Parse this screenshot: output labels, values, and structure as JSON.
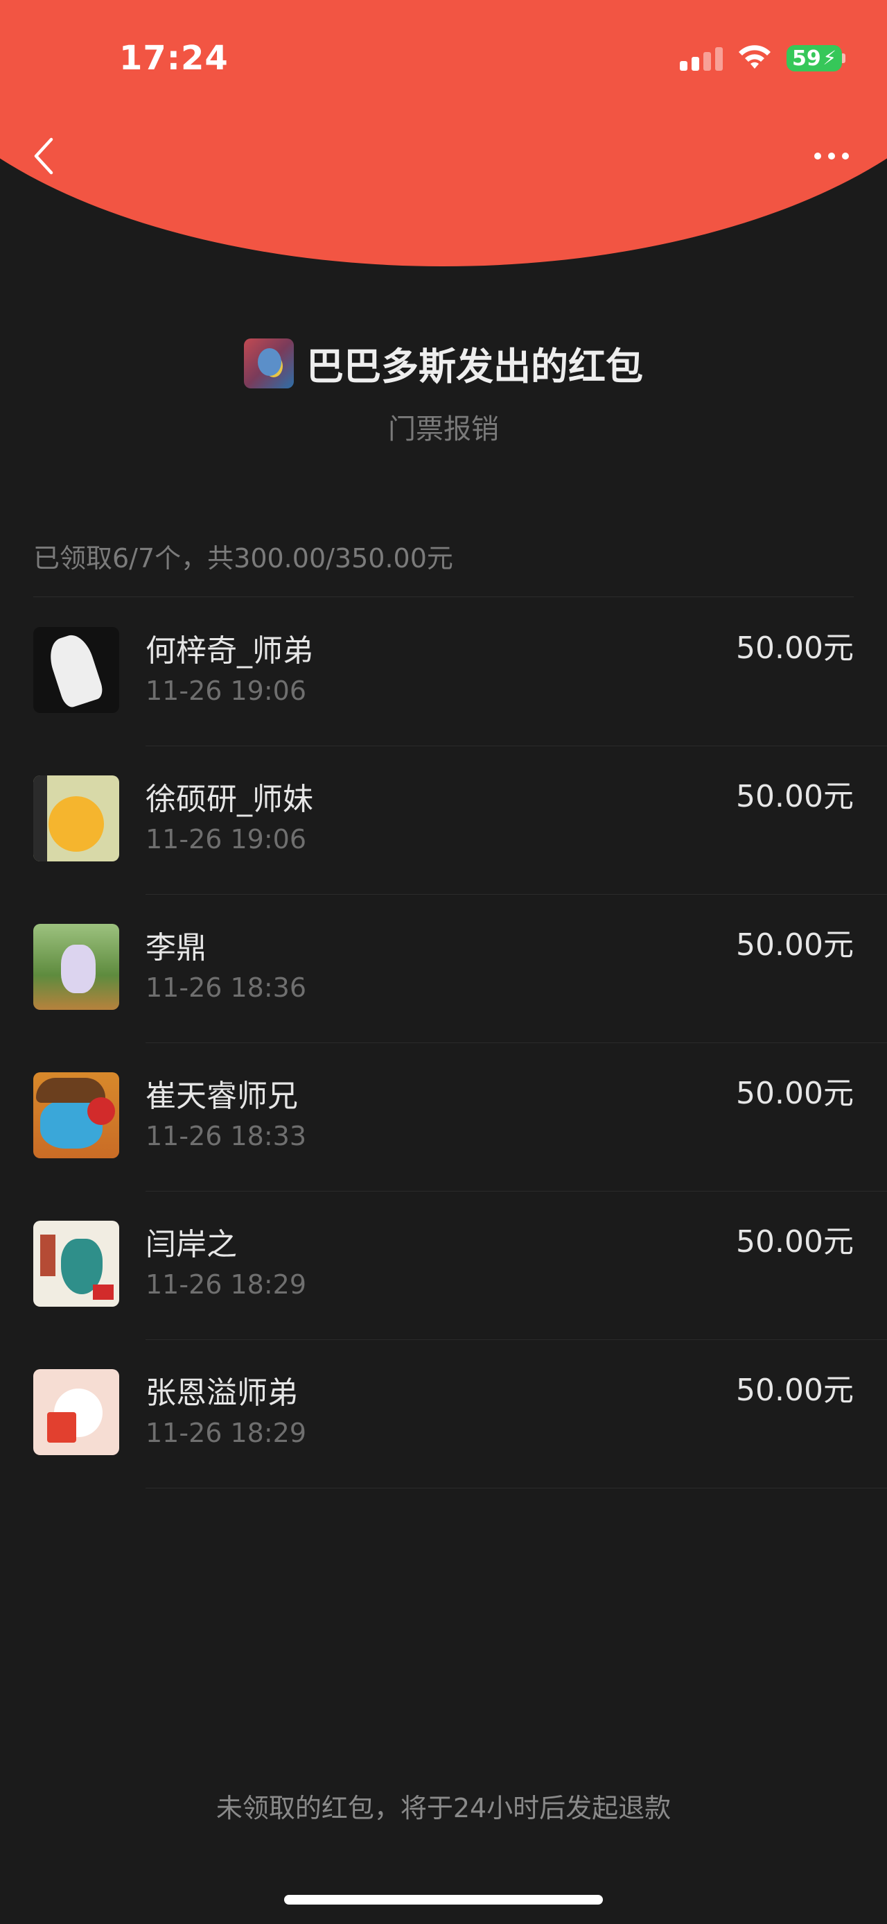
{
  "status_bar": {
    "time": "17:24",
    "battery": "59"
  },
  "header": {
    "back_icon": "chevron-left-icon",
    "more_icon": "more-icon"
  },
  "sender": {
    "title": "巴巴多斯发出的红包",
    "subtitle": "门票报销"
  },
  "summary": "已领取6/7个，共300.00/350.00元",
  "recipients": [
    {
      "name": "何梓奇_师弟",
      "time": "11-26 19:06",
      "amount": "50.00元"
    },
    {
      "name": "徐硕研_师妹",
      "time": "11-26 19:06",
      "amount": "50.00元"
    },
    {
      "name": "李鼎",
      "time": "11-26 18:36",
      "amount": "50.00元"
    },
    {
      "name": "崔天睿师兄",
      "time": "11-26 18:33",
      "amount": "50.00元"
    },
    {
      "name": "闫岸之",
      "time": "11-26 18:29",
      "amount": "50.00元"
    },
    {
      "name": "张恩溢师弟",
      "time": "11-26 18:29",
      "amount": "50.00元"
    }
  ],
  "footer_note": "未领取的红包，将于24小时后发起退款",
  "colors": {
    "header_red": "#f25543",
    "background": "#1b1b1b",
    "battery_green": "#36c759"
  }
}
